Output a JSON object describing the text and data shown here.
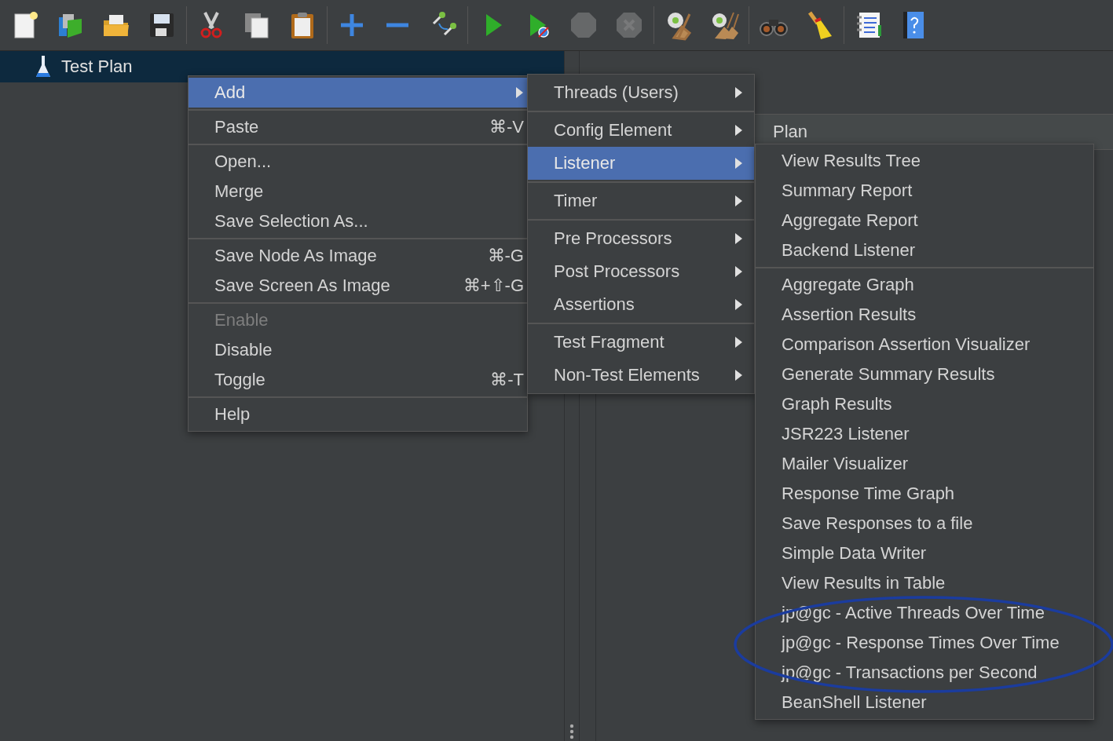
{
  "toolbar": {
    "groups": [
      [
        {
          "kind": "new",
          "disabled": false
        },
        {
          "kind": "templates",
          "disabled": false
        },
        {
          "kind": "open",
          "disabled": false
        },
        {
          "kind": "save",
          "disabled": false
        }
      ],
      [
        {
          "kind": "cut",
          "disabled": false
        },
        {
          "kind": "copy",
          "disabled": false
        },
        {
          "kind": "paste",
          "disabled": false
        }
      ],
      [
        {
          "kind": "expand",
          "disabled": false
        },
        {
          "kind": "collapse",
          "disabled": false
        },
        {
          "kind": "toggle",
          "disabled": false
        }
      ],
      [
        {
          "kind": "start",
          "disabled": false
        },
        {
          "kind": "start_no_pause",
          "disabled": false
        },
        {
          "kind": "stop",
          "disabled": true
        },
        {
          "kind": "shutdown",
          "disabled": true
        }
      ],
      [
        {
          "kind": "clear",
          "disabled": false
        },
        {
          "kind": "clear_all",
          "disabled": false
        }
      ],
      [
        {
          "kind": "search",
          "disabled": false
        },
        {
          "kind": "reset_search",
          "disabled": false
        }
      ],
      [
        {
          "kind": "function_helper",
          "disabled": false
        },
        {
          "kind": "help",
          "disabled": false
        }
      ]
    ]
  },
  "tree": {
    "items": [
      {
        "label": "Test Plan",
        "selected": true
      }
    ]
  },
  "editor": {
    "title": "Plan"
  },
  "context_menu": {
    "groups": [
      [
        {
          "label": "Add",
          "submenu": true,
          "disabled": false,
          "selected": true
        }
      ],
      [
        {
          "label": "Paste",
          "shortcut": "⌘-V",
          "submenu": false,
          "disabled": false,
          "selected": false
        }
      ],
      [
        {
          "label": "Open...",
          "submenu": false,
          "disabled": false,
          "selected": false
        },
        {
          "label": "Merge",
          "submenu": false,
          "disabled": false,
          "selected": false
        },
        {
          "label": "Save Selection As...",
          "submenu": false,
          "disabled": false,
          "selected": false
        }
      ],
      [
        {
          "label": "Save Node As Image",
          "shortcut": "⌘-G",
          "submenu": false,
          "disabled": false,
          "selected": false
        },
        {
          "label": "Save Screen As Image",
          "shortcut": "⌘+⇧-G",
          "submenu": false,
          "disabled": false,
          "selected": false
        }
      ],
      [
        {
          "label": "Enable",
          "submenu": false,
          "disabled": true,
          "selected": false
        },
        {
          "label": "Disable",
          "submenu": false,
          "disabled": false,
          "selected": false
        },
        {
          "label": "Toggle",
          "shortcut": "⌘-T",
          "submenu": false,
          "disabled": false,
          "selected": false
        }
      ],
      [
        {
          "label": "Help",
          "submenu": false,
          "disabled": false,
          "selected": false
        }
      ]
    ]
  },
  "add_menu": {
    "groups": [
      [
        {
          "label": "Threads (Users)",
          "submenu": true,
          "selected": false
        }
      ],
      [
        {
          "label": "Config Element",
          "submenu": true,
          "selected": false
        },
        {
          "label": "Listener",
          "submenu": true,
          "selected": true
        }
      ],
      [
        {
          "label": "Timer",
          "submenu": true,
          "selected": false
        }
      ],
      [
        {
          "label": "Pre Processors",
          "submenu": true,
          "selected": false
        },
        {
          "label": "Post Processors",
          "submenu": true,
          "selected": false
        },
        {
          "label": "Assertions",
          "submenu": true,
          "selected": false
        }
      ],
      [
        {
          "label": "Test Fragment",
          "submenu": true,
          "selected": false
        },
        {
          "label": "Non-Test Elements",
          "submenu": true,
          "selected": false
        }
      ]
    ]
  },
  "listener_menu": {
    "groups": [
      [
        {
          "label": "View Results Tree"
        },
        {
          "label": "Summary Report"
        },
        {
          "label": "Aggregate Report"
        },
        {
          "label": "Backend Listener"
        }
      ],
      [
        {
          "label": "Aggregate Graph"
        },
        {
          "label": "Assertion Results"
        },
        {
          "label": "Comparison Assertion Visualizer"
        },
        {
          "label": "Generate Summary Results"
        },
        {
          "label": "Graph Results"
        },
        {
          "label": "JSR223 Listener"
        },
        {
          "label": "Mailer Visualizer"
        },
        {
          "label": "Response Time Graph"
        },
        {
          "label": "Save Responses to a file"
        },
        {
          "label": "Simple Data Writer"
        },
        {
          "label": "View Results in Table"
        },
        {
          "label": "jp@gc - Active Threads Over Time"
        },
        {
          "label": "jp@gc - Response Times Over Time"
        },
        {
          "label": "jp@gc - Transactions per Second"
        },
        {
          "label": "BeanShell Listener"
        }
      ]
    ]
  },
  "annotation": {
    "kind": "ellipse"
  }
}
